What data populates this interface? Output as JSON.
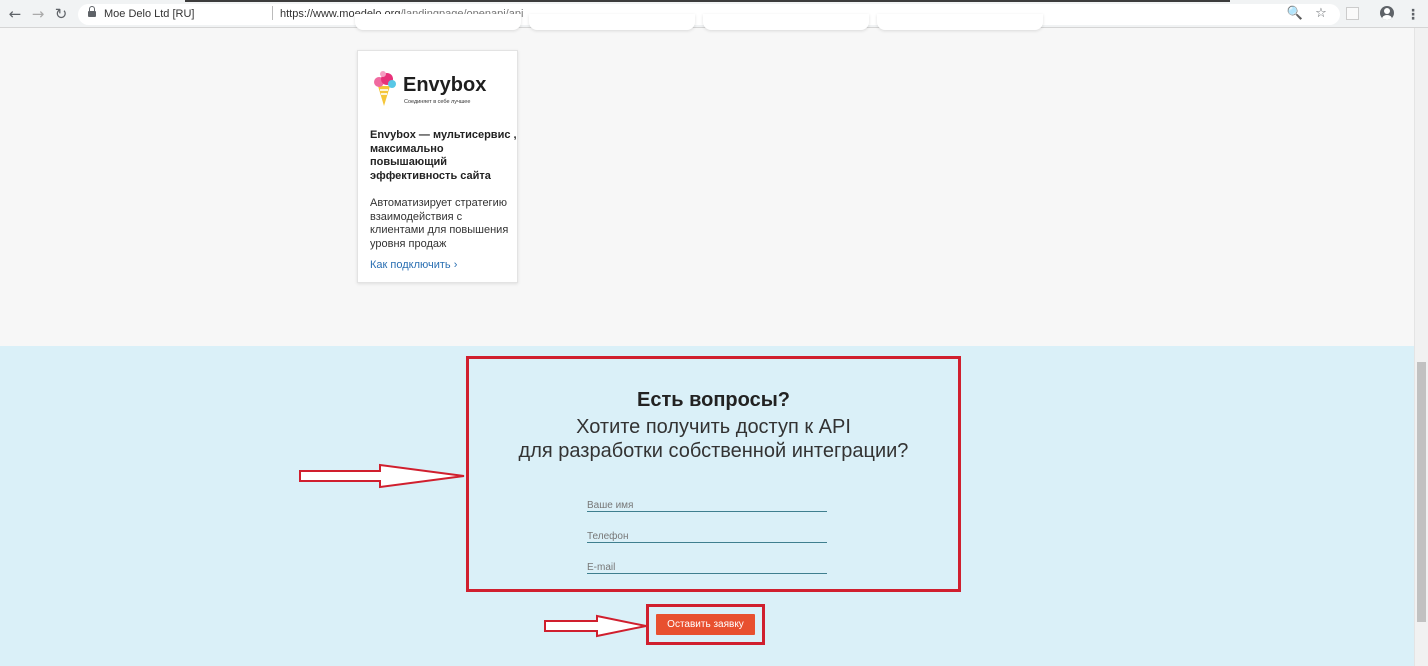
{
  "browser": {
    "back_icon": "arrow-left-icon",
    "forward_icon": "arrow-right-icon",
    "reload_icon": "reload-icon",
    "back_glyph": "←",
    "forward_glyph": "→",
    "reload_glyph": "↻",
    "site_name": "Moe Delo Ltd [RU]",
    "url_host": "https://www.moedelo.org",
    "url_path": "/landingpage/openapi/api",
    "zoom_glyph": "🔍",
    "star_glyph": "☆",
    "menu_glyph": "⋮"
  },
  "card": {
    "logo_word": "Envybox",
    "logo_tagline": "Соединяет в себе лучшее",
    "title": "Envybox — мультисервис , максимально повышающий эффективность сайта",
    "description": "Автоматизирует стратегию взаимодействия с клиентами для повышения уровня продаж",
    "link": "Как подключить ›"
  },
  "contact": {
    "title": "Есть вопросы?",
    "subtitle_line1": "Хотите получить доступ к API",
    "subtitle_line2": "для разработки собственной интеграции?",
    "name_placeholder": "Ваше имя",
    "phone_placeholder": "Телефон",
    "email_placeholder": "E-mail",
    "submit_label": "Оставить заявку"
  },
  "colors": {
    "section_bg": "#daf0f8",
    "highlight": "#d01f2e",
    "button": "#e8502f",
    "link": "#2a6fb2"
  }
}
